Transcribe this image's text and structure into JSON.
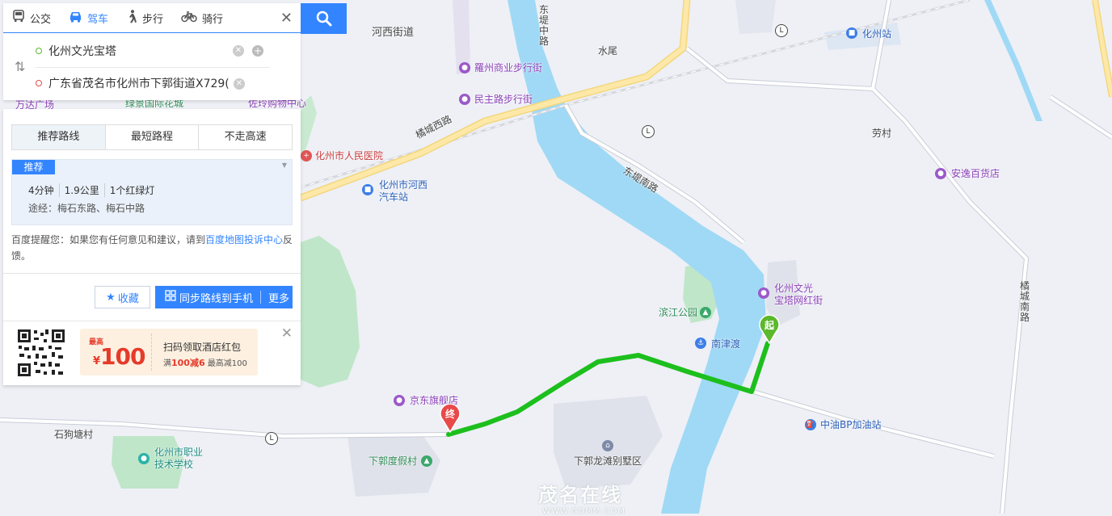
{
  "map": {
    "labels": {
      "hexi_street": "河西街道",
      "shuiwei": "水尾",
      "huazhou_station": "化州站",
      "luozhou_walk": "羅州商业步行街",
      "minzhu_walk": "民主路步行街",
      "laocun": "劳村",
      "anyi_store": "安逸百货店",
      "juecheng_west": "橘城西路",
      "dongdi_south": "东堤南路",
      "dongdi_middle": "东堤中路",
      "hospital": "化州市人民医院",
      "hexi_bus_1": "化州市河西",
      "hexi_bus_2": "汽车站",
      "wenguang_1": "化州文光",
      "wenguang_2": "宝塔网红街",
      "binjiang_park": "滨江公园",
      "nanjindu": "南津渡",
      "jd_store": "京东旗舰店",
      "cnpc": "中油BP加油站",
      "xiaguo_resort": "下郭度假村",
      "xiaguo_villa": "下郭龙滩别墅区",
      "shigoutang": "石狗塘村",
      "vocational_1": "化州市职业",
      "vocational_2": "技术学校",
      "lvjing": "绿景国际花城",
      "zuoling": "佐玲购物中心",
      "wanda": "万达广场",
      "juecheng_south": "橘城南路",
      "start_marker": "起",
      "end_marker": "终"
    },
    "watermark_en": "WWW.GDMM.COM",
    "watermark_cn": "茂名在线"
  },
  "transport_modes": [
    {
      "label": "公交",
      "icon": "bus-icon",
      "active": false
    },
    {
      "label": "驾车",
      "icon": "car-icon",
      "active": true
    },
    {
      "label": "步行",
      "icon": "walk-icon",
      "active": false
    },
    {
      "label": "骑行",
      "icon": "bike-icon",
      "active": false
    }
  ],
  "route_input": {
    "start": "化州文光宝塔",
    "end": "广东省茂名市化州市下郭街道X729("
  },
  "route_tabs": [
    "推荐路线",
    "最短路程",
    "不走高速"
  ],
  "route_card": {
    "badge": "推荐",
    "time": "4分钟",
    "distance": "1.9公里",
    "lights": "1个红绿灯",
    "via": "途经：梅石东路、梅石中路"
  },
  "tip": {
    "prefix": "百度提醒您：如果您有任何意见和建议，请到",
    "link": "百度地图投诉中心",
    "suffix": "反馈。"
  },
  "actions": {
    "favorite": "收藏",
    "sync": "同步路线到手机",
    "more": "更多"
  },
  "promo": {
    "tag": "最高",
    "currency": "¥",
    "amount": "100",
    "title": "扫码领取酒店红包",
    "line_prefix": "满",
    "line_hl": "100减6",
    "line_suffix": "最高减100"
  },
  "colors": {
    "accent": "#3385ff",
    "route": "#1dbf1d",
    "river": "#9fd9f5",
    "park": "#bfe6c8",
    "road_major": "#fde8a8"
  }
}
